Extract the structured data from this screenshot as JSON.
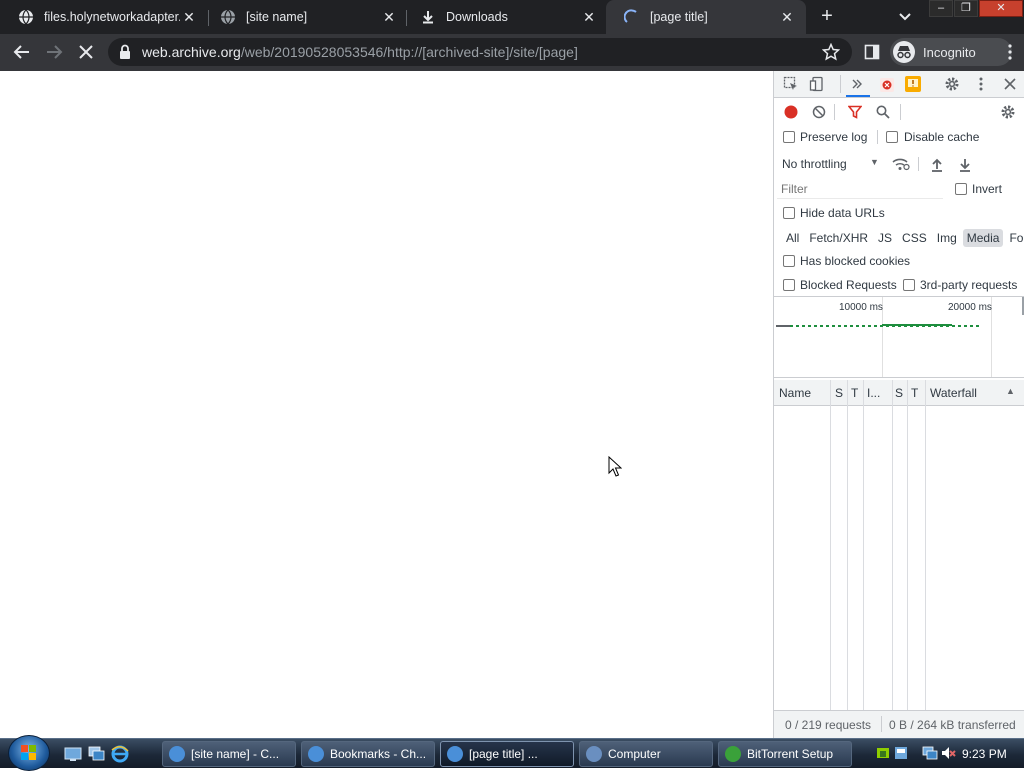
{
  "browser": {
    "tabs": [
      {
        "title": "files.holynetworkadapter.",
        "icon": "globe-icon",
        "close": "✕"
      },
      {
        "title": "[site name]",
        "icon": "globe-icon",
        "close": "✕"
      },
      {
        "title": "Downloads",
        "icon": "download-icon",
        "close": "✕"
      },
      {
        "title": "[page title]",
        "icon": "loading-spinner-icon",
        "close": "✕"
      }
    ],
    "new_tab": "+",
    "window_buttons": {
      "minimize": "–",
      "maximize": "❐",
      "close": "✕"
    },
    "address": {
      "host": "web.archive.org",
      "path": "/web/20190528053546/http://[archived-site]/site/[page]"
    },
    "incognito_label": "Incognito"
  },
  "devtools": {
    "preserve_log": "Preserve log",
    "disable_cache": "Disable cache",
    "throttling": "No throttling",
    "throttling_arrow": "▼",
    "filter_placeholder": "Filter",
    "invert": "Invert",
    "hide_data_urls": "Hide data URLs",
    "types": [
      "All",
      "Fetch/XHR",
      "JS",
      "CSS",
      "Img",
      "Media",
      "Font"
    ],
    "selected_type": "Media",
    "has_blocked_cookies": "Has blocked cookies",
    "blocked_requests": "Blocked Requests",
    "third_party": "3rd-party requests",
    "overview": {
      "tick1": "10000 ms",
      "tick2": "20000 ms"
    },
    "columns": [
      "Name",
      "S",
      "T",
      "I...",
      "S",
      "T",
      "Waterfall"
    ],
    "sort_arrow": "▲",
    "status": {
      "requests": "0 / 219 requests",
      "transferred": "0 B / 264 kB transferred"
    }
  },
  "taskbar": {
    "items": [
      {
        "label": "[site name] - C...",
        "color": "#4a8fd8"
      },
      {
        "label": "Bookmarks - Ch...",
        "color": "#4a8fd8"
      },
      {
        "label": "[page title] ...",
        "color": "#4a8fd8"
      },
      {
        "label": "Computer",
        "color": "#6a8fc0"
      },
      {
        "label": "BitTorrent Setup",
        "color": "#3aa13a"
      }
    ],
    "clock": "9:23 PM"
  },
  "colors": {
    "record": "#d93025",
    "filter_active": "#d93025",
    "warning": "#f9ab00"
  }
}
